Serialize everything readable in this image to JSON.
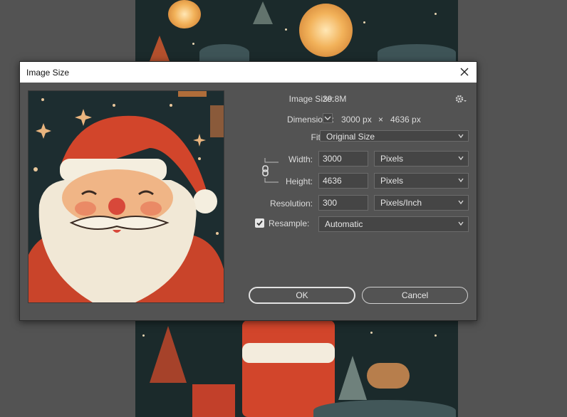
{
  "dialog": {
    "title": "Image Size",
    "image_size_label": "Image Size:",
    "image_size_value": "39.8M",
    "settings_icon": "gear-icon",
    "dimensions_label": "Dimensions:",
    "dimensions_width": "3000 px",
    "dimensions_times": "×",
    "dimensions_height": "4636 px",
    "fit_to_label": "Fit To:",
    "fit_to_value": "Original Size",
    "width_label": "Width:",
    "width_value": "3000",
    "width_unit": "Pixels",
    "height_label": "Height:",
    "height_value": "4636",
    "height_unit": "Pixels",
    "link_icon": "chain-link-icon",
    "resolution_label": "Resolution:",
    "resolution_value": "300",
    "resolution_unit": "Pixels/Inch",
    "resample_label": "Resample:",
    "resample_checked": true,
    "resample_value": "Automatic",
    "ok_label": "OK",
    "cancel_label": "Cancel"
  },
  "colors": {
    "app_background": "#535353",
    "dialog_background": "#535353",
    "titlebar": "#ffffff",
    "santa_red": "#d2452b"
  }
}
